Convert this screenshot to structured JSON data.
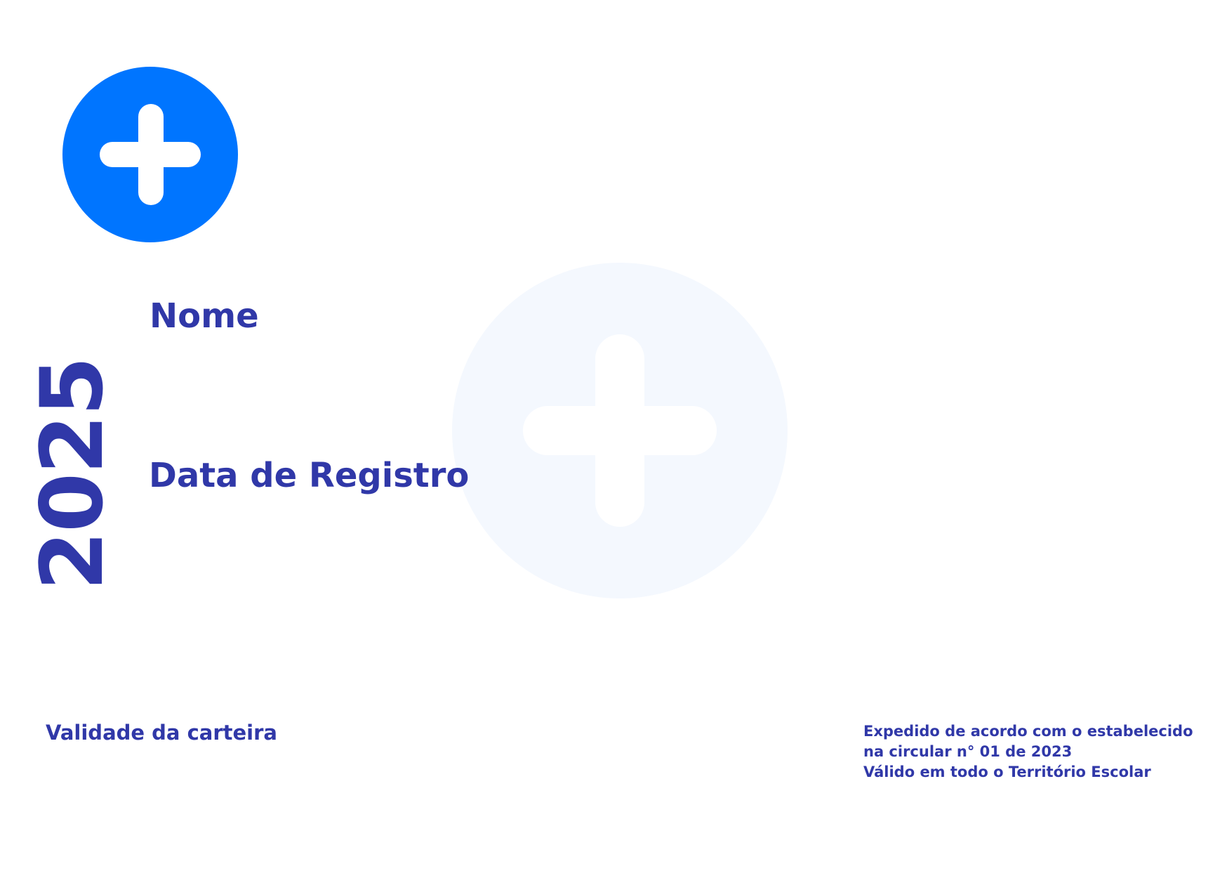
{
  "colors": {
    "text_primary": "#3038a8",
    "logo_blue": "#0075ff",
    "watermark_tint": "#f4f8fe",
    "background": "#ffffff"
  },
  "icons": {
    "logo": "plus-circle-icon",
    "watermark": "plus-circle-icon"
  },
  "card": {
    "name_label": "Nome",
    "registration_date_label": "Data de Registro",
    "year": "2025",
    "validity_label": "Validade da carteira",
    "legal_lines": [
      "Expedido de acordo com o estabelecido",
      "na circular n° 01 de 2023",
      "Válido em todo o Território Escolar"
    ]
  }
}
